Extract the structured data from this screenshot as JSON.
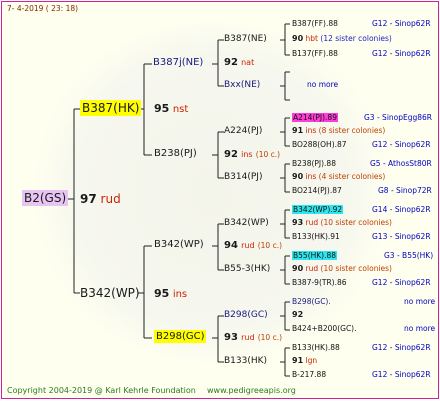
{
  "header": {
    "date": "7- 4-2019 ( 23: 18)"
  },
  "footer": {
    "copyright": "Copyright 2004-2019 @ Karl Kehrle Foundation",
    "url": "www.pedigreeapis.org"
  },
  "root": {
    "id": "B2(GS)",
    "num": "97",
    "suffix": "rud"
  },
  "gen1": [
    {
      "id": "B387(HK)",
      "num": "95",
      "suffix": "nst"
    },
    {
      "id": "B342(WP)",
      "num": "95",
      "suffix": "ins"
    }
  ],
  "gen2": [
    {
      "id": "B387j(NE)"
    },
    {
      "id": "B238(PJ)"
    },
    {
      "id": "B342(WP)"
    },
    {
      "id": "B298(GC)"
    }
  ],
  "gen3": [
    {
      "id": "B387(NE)",
      "num": "92",
      "suffix": "nat"
    },
    {
      "id": "Bxx(NE)"
    },
    {
      "id": "A224(PJ)",
      "num": "91",
      "suffix": "ins",
      "extra": "(8 sister colonies)"
    },
    {
      "id": "B314(PJ)",
      "num": "90",
      "suffix": "ins",
      "extra": "(4 sister colonies)"
    },
    {
      "id": "B342(WP)",
      "num": "93",
      "suffix": "rud",
      "extra": "(10 sister colonies)"
    },
    {
      "id": "B55-3(HK)",
      "num": "90",
      "suffix": "rud",
      "extra": "(10 sister colonies)"
    },
    {
      "id": "B298(GC)",
      "num": "92"
    },
    {
      "id": "B133(HK)",
      "num": "91",
      "suffix": "lgn"
    }
  ],
  "gen2_mid": [
    {
      "num": "92",
      "suffix": "ins",
      "extra": "(10 c.)"
    },
    {
      "num": "94",
      "suffix": "rud",
      "extra": "(10 c.)"
    },
    {
      "num": "93",
      "suffix": "rud",
      "extra": "(10 c.)"
    }
  ],
  "gen4": [
    {
      "a": "B387(FF).88",
      "code": "G12 - Sinop62R"
    },
    {
      "a": "B137(FF).88",
      "code": "G12 - Sinop62R"
    },
    {
      "a": "no more"
    },
    {
      "a": "A214(PJ).89",
      "code": "G3 - SinopEgg86R"
    },
    {
      "a": "BO288(OH).87",
      "code": "G12 - Sinop62R"
    },
    {
      "a": "B238(PJ).88",
      "code": "G5 - AthosSt80R"
    },
    {
      "a": "BO214(PJ).87",
      "code": "G8 - Sinop72R"
    },
    {
      "a": "B342(WP).92",
      "code": "G14 - Sinop62R"
    },
    {
      "a": "B133(HK).91",
      "code": "G13 - Sinop62R"
    },
    {
      "a": "B55(HK).88",
      "code": "G3 - B55(HK)"
    },
    {
      "a": "B387-9(TR).86",
      "code": "G12 - Sinop62R"
    },
    {
      "a": "B298(GC).",
      "code": "no more"
    },
    {
      "a": "B424+B200(GC).",
      "code": "no more"
    },
    {
      "a": "B133(HK).88",
      "code": "G12 - Sinop62R"
    },
    {
      "a": "B-217.88",
      "code": "G12 - Sinop62R"
    }
  ],
  "gen3_top": {
    "num": "90",
    "suffix": "hbt",
    "extra": "(12 sister colonies)"
  }
}
